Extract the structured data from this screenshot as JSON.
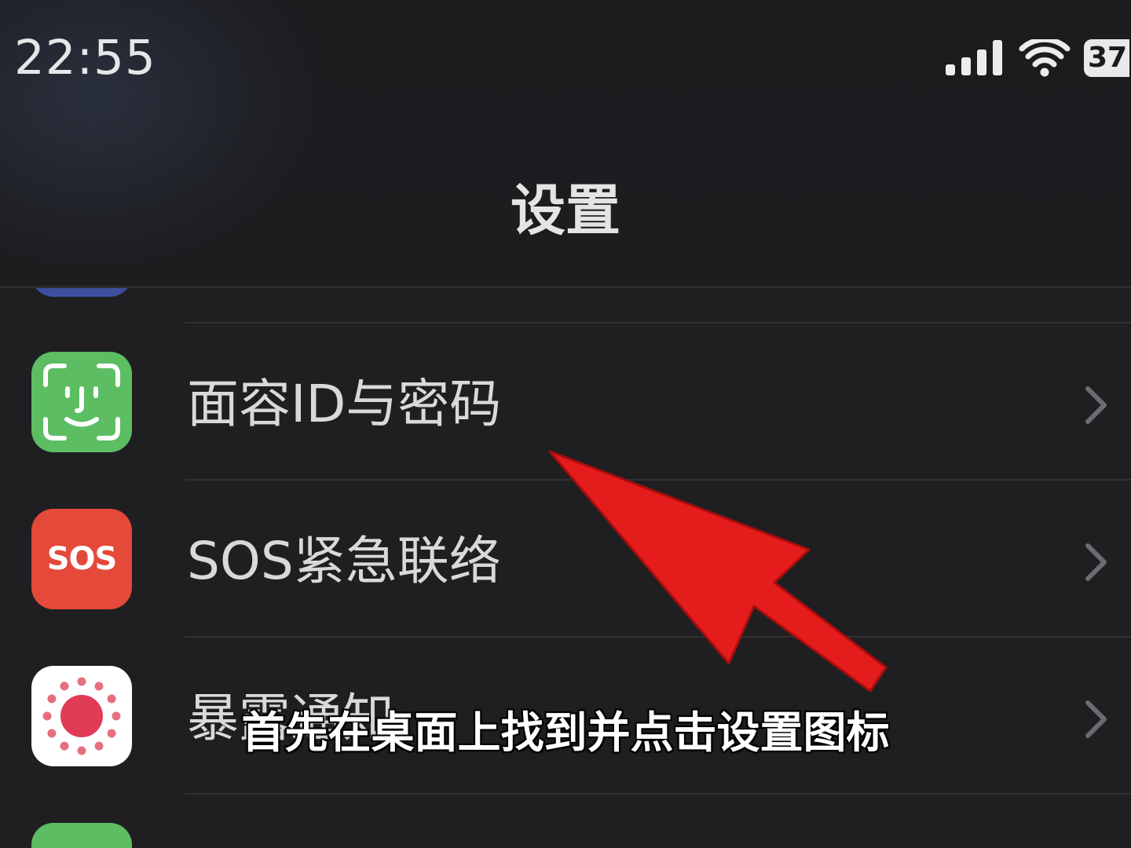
{
  "status_bar": {
    "time": "22:55",
    "battery_level": "37",
    "signal_icon": "cellular-signal-icon",
    "wifi_icon": "wifi-icon",
    "battery_icon": "battery-icon"
  },
  "nav": {
    "title": "设置"
  },
  "settings_rows": [
    {
      "label": "面容ID与密码",
      "icon": "face-id-icon",
      "icon_bg": "#5dbd63"
    },
    {
      "label": "SOS紧急联络",
      "icon": "sos-icon",
      "icon_text": "SOS",
      "icon_bg": "#e4493a"
    },
    {
      "label": "暴露通知",
      "icon": "exposure-notification-icon",
      "icon_bg": "#ffffff"
    },
    {
      "icon": "app-icon",
      "icon_bg": "#5dbd63"
    }
  ],
  "row_chevron_icon": "chevron-right-icon",
  "annotation": {
    "arrow_icon": "red-arrow-icon",
    "arrow_color": "#e51c1c"
  },
  "caption": "首先在桌面上找到并点击设置图标",
  "colors": {
    "background": "#1f1f21",
    "text": "#d9d9db",
    "separator": "#313134",
    "chevron": "#6c6c70"
  }
}
